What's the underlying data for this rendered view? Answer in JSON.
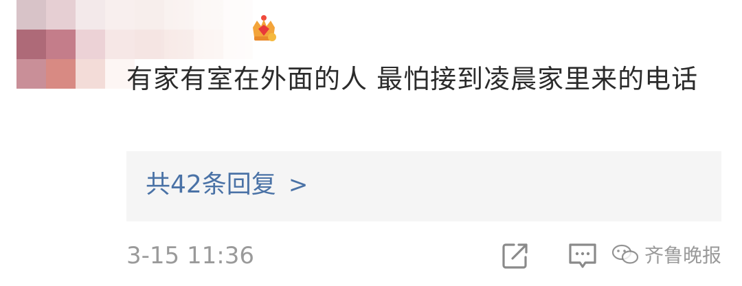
{
  "comment": {
    "text": "有家有室在外面的人 最怕接到凌晨家里来的电话",
    "replies_link": "共42条回复",
    "replies_chevron": ">",
    "timestamp": "3-15 11:36"
  },
  "watermark": {
    "text": "齐鲁晚报"
  },
  "colors": {
    "link": "#4a72a6",
    "muted": "#9a9a9a",
    "reply_bg": "#f5f5f5",
    "text": "#2b2b2b"
  },
  "icons": {
    "share": "share-icon",
    "comment": "comment-icon",
    "like": "like-icon",
    "badge": "crown-badge-icon",
    "watermark_logo": "wechat-icon"
  }
}
